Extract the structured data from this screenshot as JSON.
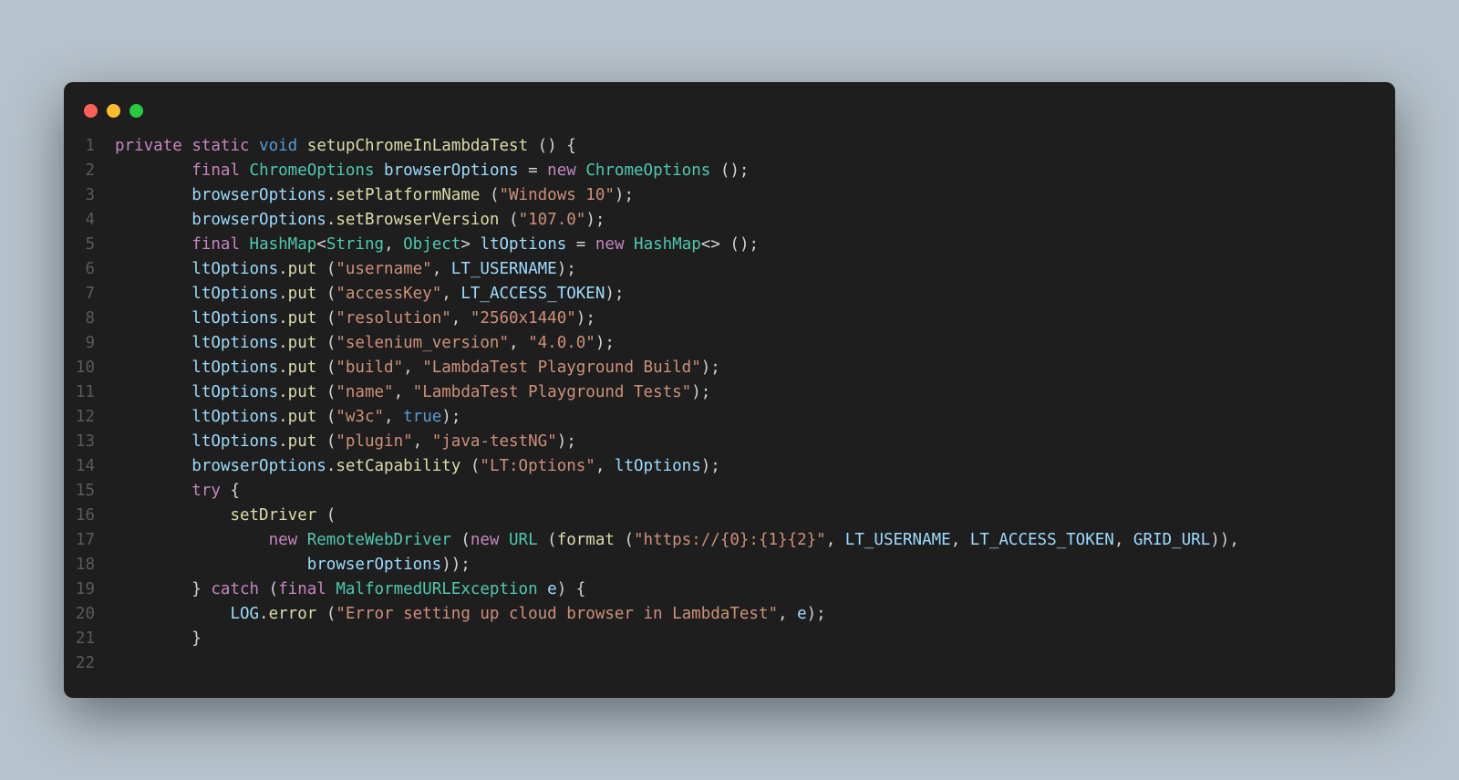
{
  "window": {
    "traffic": [
      "red",
      "yellow",
      "green"
    ]
  },
  "code": {
    "lines": [
      {
        "n": 1,
        "tokens": [
          [
            "kw",
            "private"
          ],
          [
            "punc",
            " "
          ],
          [
            "kw",
            "static"
          ],
          [
            "punc",
            " "
          ],
          [
            "kw2",
            "void"
          ],
          [
            "punc",
            " "
          ],
          [
            "fn",
            "setupChromeInLambdaTest"
          ],
          [
            "punc",
            " () {"
          ]
        ]
      },
      {
        "n": 2,
        "tokens": [
          [
            "punc",
            "        "
          ],
          [
            "kw",
            "final"
          ],
          [
            "punc",
            " "
          ],
          [
            "type",
            "ChromeOptions"
          ],
          [
            "punc",
            " "
          ],
          [
            "var",
            "browserOptions"
          ],
          [
            "punc",
            " = "
          ],
          [
            "kw",
            "new"
          ],
          [
            "punc",
            " "
          ],
          [
            "type",
            "ChromeOptions"
          ],
          [
            "punc",
            " ();"
          ]
        ]
      },
      {
        "n": 3,
        "tokens": [
          [
            "punc",
            "        "
          ],
          [
            "var",
            "browserOptions"
          ],
          [
            "punc",
            "."
          ],
          [
            "fn",
            "setPlatformName"
          ],
          [
            "punc",
            " ("
          ],
          [
            "str",
            "\"Windows 10\""
          ],
          [
            "punc",
            ");"
          ]
        ]
      },
      {
        "n": 4,
        "tokens": [
          [
            "punc",
            "        "
          ],
          [
            "var",
            "browserOptions"
          ],
          [
            "punc",
            "."
          ],
          [
            "fn",
            "setBrowserVersion"
          ],
          [
            "punc",
            " ("
          ],
          [
            "str",
            "\"107.0\""
          ],
          [
            "punc",
            ");"
          ]
        ]
      },
      {
        "n": 5,
        "tokens": [
          [
            "punc",
            "        "
          ],
          [
            "kw",
            "final"
          ],
          [
            "punc",
            " "
          ],
          [
            "type",
            "HashMap"
          ],
          [
            "punc",
            "<"
          ],
          [
            "type",
            "String"
          ],
          [
            "punc",
            ", "
          ],
          [
            "type",
            "Object"
          ],
          [
            "punc",
            "> "
          ],
          [
            "var",
            "ltOptions"
          ],
          [
            "punc",
            " = "
          ],
          [
            "kw",
            "new"
          ],
          [
            "punc",
            " "
          ],
          [
            "type",
            "HashMap"
          ],
          [
            "punc",
            "<> ();"
          ]
        ]
      },
      {
        "n": 6,
        "tokens": [
          [
            "punc",
            "        "
          ],
          [
            "var",
            "ltOptions"
          ],
          [
            "punc",
            "."
          ],
          [
            "fn",
            "put"
          ],
          [
            "punc",
            " ("
          ],
          [
            "str",
            "\"username\""
          ],
          [
            "punc",
            ", "
          ],
          [
            "const",
            "LT_USERNAME"
          ],
          [
            "punc",
            ");"
          ]
        ]
      },
      {
        "n": 7,
        "tokens": [
          [
            "punc",
            "        "
          ],
          [
            "var",
            "ltOptions"
          ],
          [
            "punc",
            "."
          ],
          [
            "fn",
            "put"
          ],
          [
            "punc",
            " ("
          ],
          [
            "str",
            "\"accessKey\""
          ],
          [
            "punc",
            ", "
          ],
          [
            "const",
            "LT_ACCESS_TOKEN"
          ],
          [
            "punc",
            ");"
          ]
        ]
      },
      {
        "n": 8,
        "tokens": [
          [
            "punc",
            "        "
          ],
          [
            "var",
            "ltOptions"
          ],
          [
            "punc",
            "."
          ],
          [
            "fn",
            "put"
          ],
          [
            "punc",
            " ("
          ],
          [
            "str",
            "\"resolution\""
          ],
          [
            "punc",
            ", "
          ],
          [
            "str",
            "\"2560x1440\""
          ],
          [
            "punc",
            ");"
          ]
        ]
      },
      {
        "n": 9,
        "tokens": [
          [
            "punc",
            "        "
          ],
          [
            "var",
            "ltOptions"
          ],
          [
            "punc",
            "."
          ],
          [
            "fn",
            "put"
          ],
          [
            "punc",
            " ("
          ],
          [
            "str",
            "\"selenium_version\""
          ],
          [
            "punc",
            ", "
          ],
          [
            "str",
            "\"4.0.0\""
          ],
          [
            "punc",
            ");"
          ]
        ]
      },
      {
        "n": 10,
        "tokens": [
          [
            "punc",
            "        "
          ],
          [
            "var",
            "ltOptions"
          ],
          [
            "punc",
            "."
          ],
          [
            "fn",
            "put"
          ],
          [
            "punc",
            " ("
          ],
          [
            "str",
            "\"build\""
          ],
          [
            "punc",
            ", "
          ],
          [
            "str",
            "\"LambdaTest Playground Build\""
          ],
          [
            "punc",
            ");"
          ]
        ]
      },
      {
        "n": 11,
        "tokens": [
          [
            "punc",
            "        "
          ],
          [
            "var",
            "ltOptions"
          ],
          [
            "punc",
            "."
          ],
          [
            "fn",
            "put"
          ],
          [
            "punc",
            " ("
          ],
          [
            "str",
            "\"name\""
          ],
          [
            "punc",
            ", "
          ],
          [
            "str",
            "\"LambdaTest Playground Tests\""
          ],
          [
            "punc",
            ");"
          ]
        ]
      },
      {
        "n": 12,
        "tokens": [
          [
            "punc",
            "        "
          ],
          [
            "var",
            "ltOptions"
          ],
          [
            "punc",
            "."
          ],
          [
            "fn",
            "put"
          ],
          [
            "punc",
            " ("
          ],
          [
            "str",
            "\"w3c\""
          ],
          [
            "punc",
            ", "
          ],
          [
            "kw2",
            "true"
          ],
          [
            "punc",
            ");"
          ]
        ]
      },
      {
        "n": 13,
        "tokens": [
          [
            "punc",
            "        "
          ],
          [
            "var",
            "ltOptions"
          ],
          [
            "punc",
            "."
          ],
          [
            "fn",
            "put"
          ],
          [
            "punc",
            " ("
          ],
          [
            "str",
            "\"plugin\""
          ],
          [
            "punc",
            ", "
          ],
          [
            "str",
            "\"java-testNG\""
          ],
          [
            "punc",
            ");"
          ]
        ]
      },
      {
        "n": 14,
        "tokens": [
          [
            "punc",
            "        "
          ],
          [
            "var",
            "browserOptions"
          ],
          [
            "punc",
            "."
          ],
          [
            "fn",
            "setCapability"
          ],
          [
            "punc",
            " ("
          ],
          [
            "str",
            "\"LT:Options\""
          ],
          [
            "punc",
            ", "
          ],
          [
            "var",
            "ltOptions"
          ],
          [
            "punc",
            ");"
          ]
        ]
      },
      {
        "n": 15,
        "tokens": [
          [
            "punc",
            "        "
          ],
          [
            "kw",
            "try"
          ],
          [
            "punc",
            " {"
          ]
        ]
      },
      {
        "n": 16,
        "tokens": [
          [
            "punc",
            "            "
          ],
          [
            "fn",
            "setDriver"
          ],
          [
            "punc",
            " ("
          ]
        ]
      },
      {
        "n": 17,
        "tokens": [
          [
            "punc",
            "                "
          ],
          [
            "kw",
            "new"
          ],
          [
            "punc",
            " "
          ],
          [
            "type",
            "RemoteWebDriver"
          ],
          [
            "punc",
            " ("
          ],
          [
            "kw",
            "new"
          ],
          [
            "punc",
            " "
          ],
          [
            "type",
            "URL"
          ],
          [
            "punc",
            " ("
          ],
          [
            "fn",
            "format"
          ],
          [
            "punc",
            " ("
          ],
          [
            "str",
            "\"https://{0}:{1}{2}\""
          ],
          [
            "punc",
            ", "
          ],
          [
            "const",
            "LT_USERNAME"
          ],
          [
            "punc",
            ", "
          ],
          [
            "const",
            "LT_ACCESS_TOKEN"
          ],
          [
            "punc",
            ", "
          ],
          [
            "const",
            "GRID_URL"
          ],
          [
            "punc",
            ")),"
          ]
        ]
      },
      {
        "n": 18,
        "tokens": [
          [
            "punc",
            "                    "
          ],
          [
            "var",
            "browserOptions"
          ],
          [
            "punc",
            "));"
          ]
        ]
      },
      {
        "n": 19,
        "tokens": [
          [
            "punc",
            "        } "
          ],
          [
            "kw",
            "catch"
          ],
          [
            "punc",
            " ("
          ],
          [
            "kw",
            "final"
          ],
          [
            "punc",
            " "
          ],
          [
            "type",
            "MalformedURLException"
          ],
          [
            "punc",
            " "
          ],
          [
            "var",
            "e"
          ],
          [
            "punc",
            ") {"
          ]
        ]
      },
      {
        "n": 20,
        "tokens": [
          [
            "punc",
            "            "
          ],
          [
            "const",
            "LOG"
          ],
          [
            "punc",
            "."
          ],
          [
            "fn",
            "error"
          ],
          [
            "punc",
            " ("
          ],
          [
            "str",
            "\"Error setting up cloud browser in LambdaTest\""
          ],
          [
            "punc",
            ", "
          ],
          [
            "var",
            "e"
          ],
          [
            "punc",
            ");"
          ]
        ]
      },
      {
        "n": 21,
        "tokens": [
          [
            "punc",
            "        }"
          ]
        ]
      },
      {
        "n": 22,
        "tokens": []
      }
    ]
  }
}
